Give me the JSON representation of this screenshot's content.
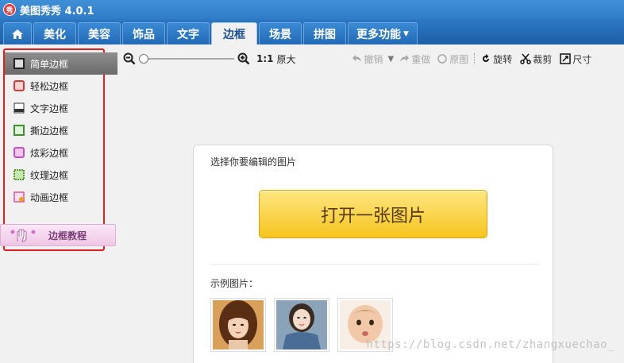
{
  "app": {
    "title": "美图秀秀 4.0.1",
    "logo_text": "秀"
  },
  "tabs": [
    {
      "label": "美化"
    },
    {
      "label": "美容"
    },
    {
      "label": "饰品"
    },
    {
      "label": "文字"
    },
    {
      "label": "边框",
      "active": true
    },
    {
      "label": "场景"
    },
    {
      "label": "拼图"
    }
  ],
  "more_tab": {
    "label": "更多功能"
  },
  "sidebar": {
    "items": [
      {
        "label": "简单边框",
        "icon": "simple-frame-icon",
        "active": true
      },
      {
        "label": "轻松边框",
        "icon": "easy-frame-icon"
      },
      {
        "label": "文字边框",
        "icon": "text-frame-icon"
      },
      {
        "label": "撕边边框",
        "icon": "torn-frame-icon"
      },
      {
        "label": "炫彩边框",
        "icon": "colorful-frame-icon"
      },
      {
        "label": "纹理边框",
        "icon": "texture-frame-icon"
      },
      {
        "label": "动画边框",
        "icon": "animation-frame-icon"
      }
    ],
    "tutorial_label": "边框教程"
  },
  "toolbar": {
    "ratio": "1:1",
    "original_size": "原大",
    "undo": "撤销",
    "redo": "重做",
    "original": "原图",
    "rotate": "旋转",
    "crop": "裁剪",
    "resize": "尺寸"
  },
  "main": {
    "hint": "选择你要编辑的图片",
    "open_button": "打开一张图片",
    "sample_label": "示例图片："
  },
  "watermark": "https://blog.csdn.net/zhangxuechao_",
  "colors": {
    "accent_blue": "#2d78c3",
    "highlight_red": "#e02020",
    "button_yellow": "#f5c51e"
  }
}
